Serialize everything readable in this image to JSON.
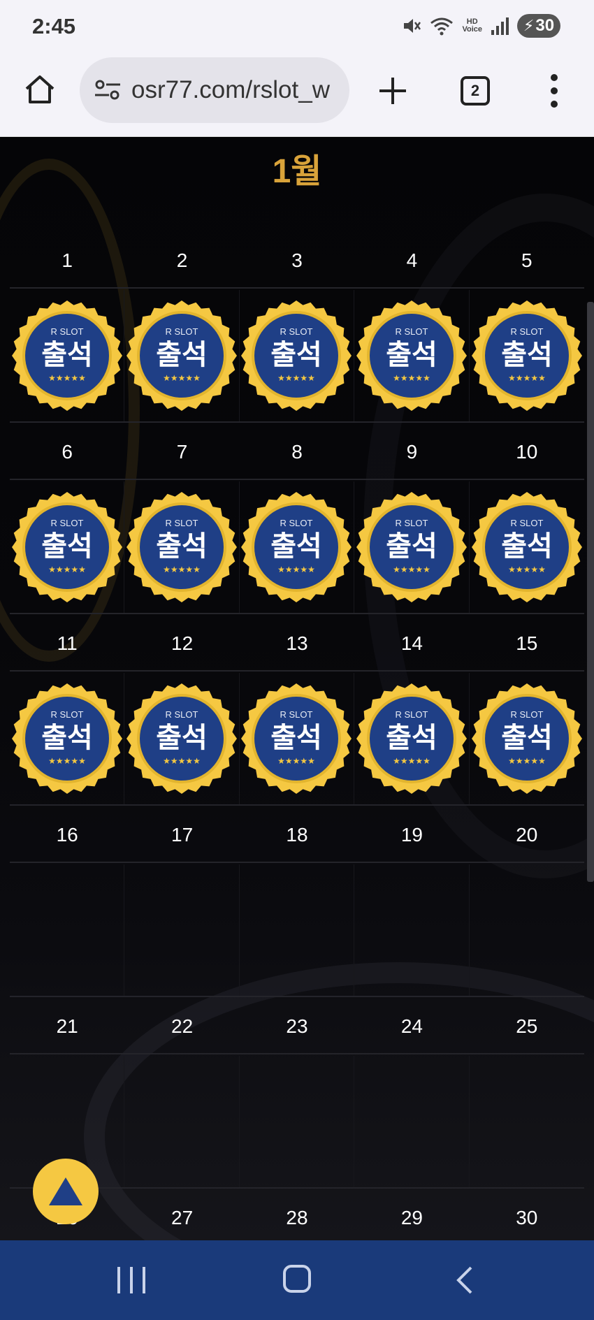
{
  "status_bar": {
    "time": "2:45",
    "icons": [
      "mute-icon",
      "wifi-icon",
      "hd-voice-icon",
      "signal-icon",
      "battery-icon"
    ],
    "hd_voice": "HD\nVoice",
    "battery_level": "30"
  },
  "browser": {
    "url": "osr77.com/rslot_w",
    "tab_count": "2"
  },
  "calendar": {
    "month_title": "1월",
    "stamp": {
      "brand": "R SLOT",
      "label": "출석",
      "stars": "★★★★★"
    },
    "weeks": [
      {
        "days": [
          "1",
          "2",
          "3",
          "4",
          "5"
        ],
        "stamped": [
          true,
          true,
          true,
          true,
          true
        ]
      },
      {
        "days": [
          "6",
          "7",
          "8",
          "9",
          "10"
        ],
        "stamped": [
          true,
          true,
          true,
          true,
          true
        ]
      },
      {
        "days": [
          "11",
          "12",
          "13",
          "14",
          "15"
        ],
        "stamped": [
          true,
          true,
          true,
          true,
          true
        ]
      },
      {
        "days": [
          "16",
          "17",
          "18",
          "19",
          "20"
        ],
        "stamped": [
          false,
          false,
          false,
          false,
          false
        ]
      },
      {
        "days": [
          "21",
          "22",
          "23",
          "24",
          "25"
        ],
        "stamped": [
          false,
          false,
          false,
          false,
          false
        ]
      },
      {
        "days": [
          "26",
          "27",
          "28",
          "29",
          "30"
        ],
        "stamped": [
          false,
          false,
          false,
          false,
          false
        ]
      }
    ]
  },
  "colors": {
    "accent_gold": "#d9a33a",
    "stamp_gold": "#f5c842",
    "stamp_blue": "#1f3f86",
    "nav_blue": "#1a3a7a"
  }
}
